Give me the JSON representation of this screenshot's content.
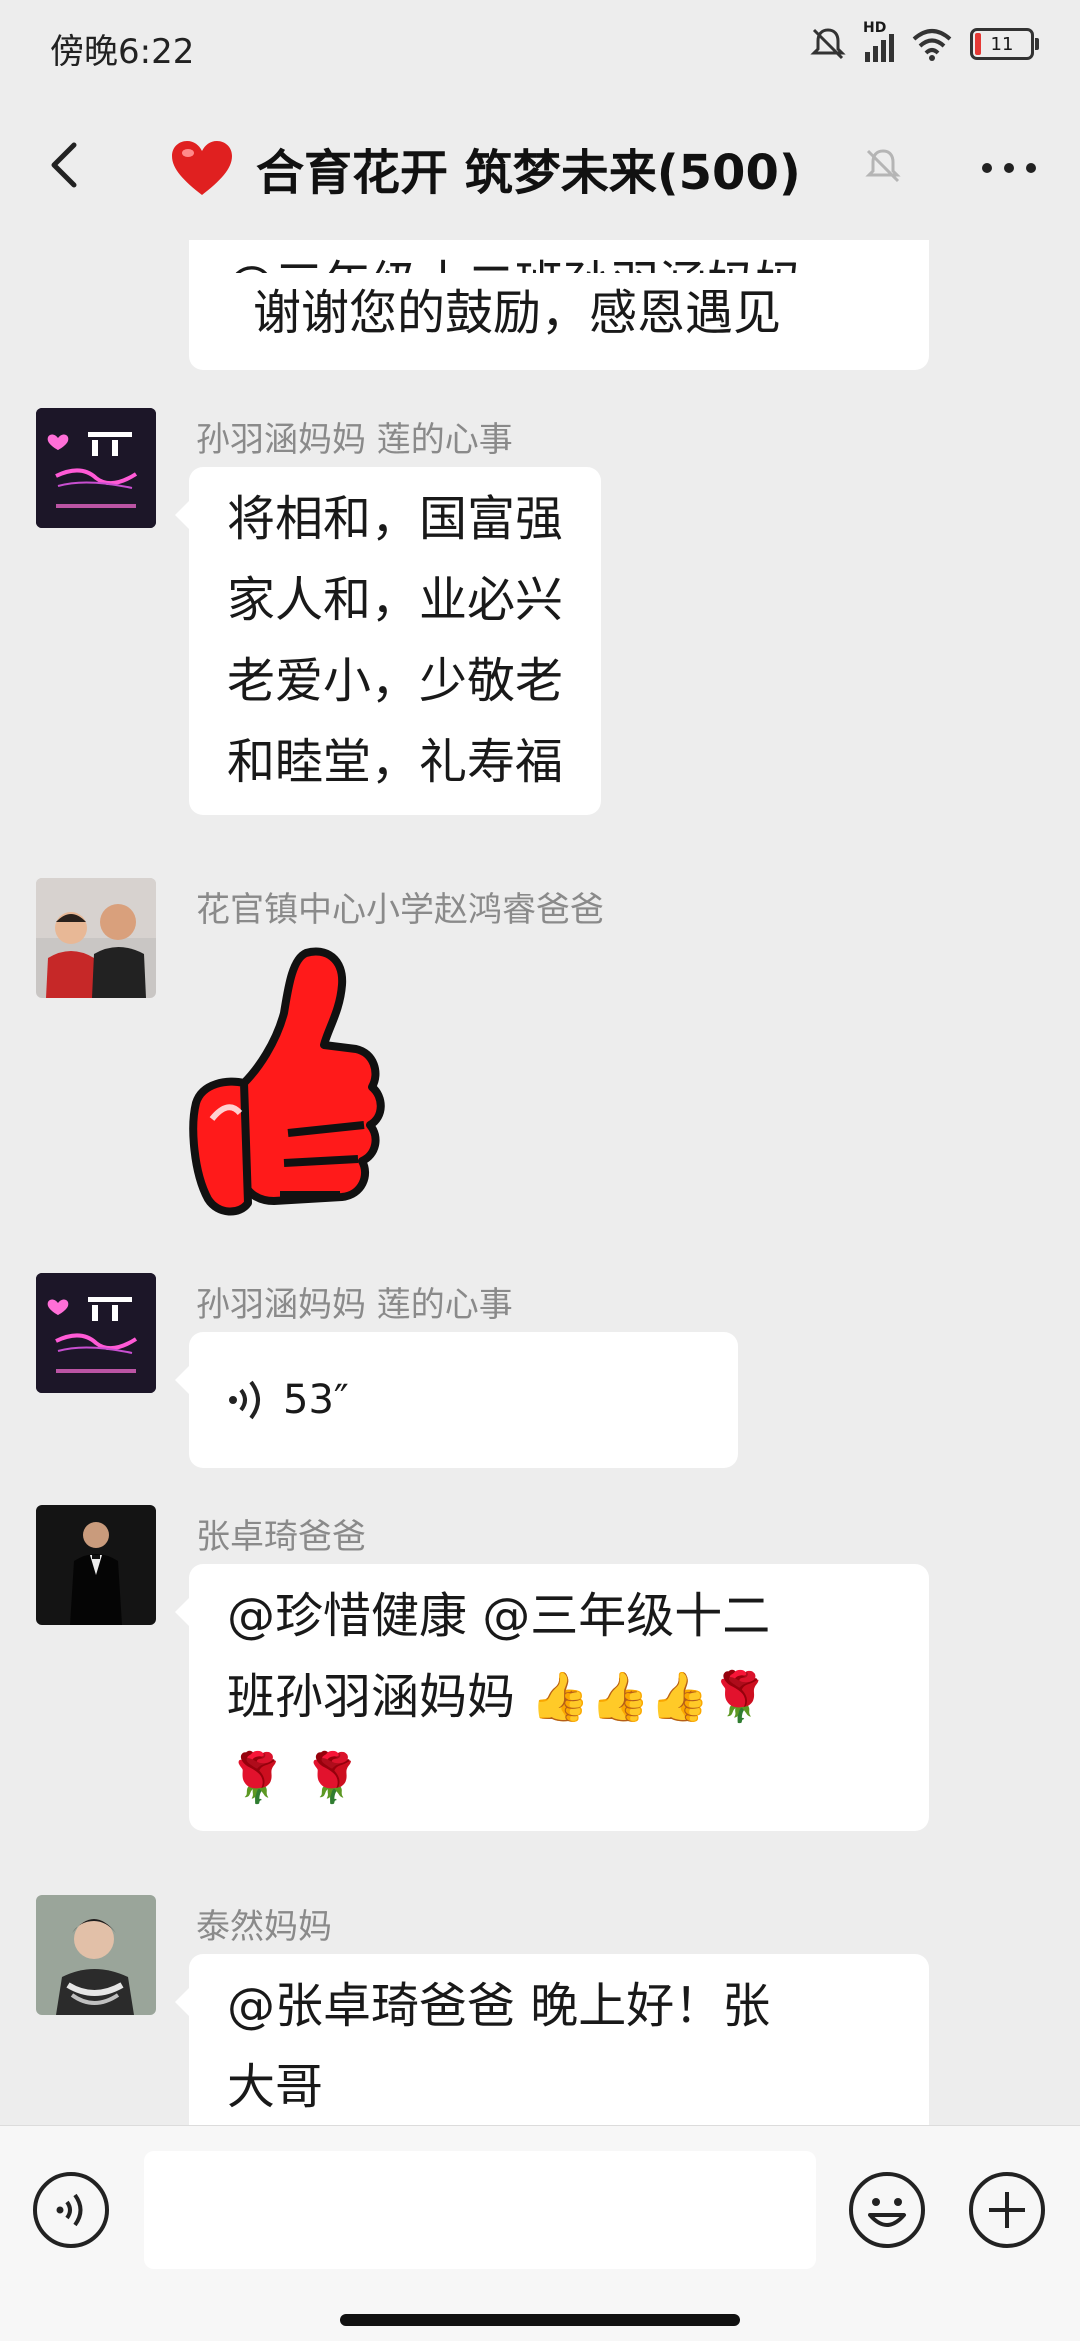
{
  "status_bar": {
    "time": "傍晚6:22",
    "battery_level": "11",
    "network": "HD"
  },
  "header": {
    "title": "合育花开 筑梦未来(500)"
  },
  "messages": [
    {
      "lines": [
        "谢谢您的鼓励，感恩遇见"
      ]
    },
    {
      "sender": "孙羽涵妈妈  莲的心事",
      "lines": [
        "将相和，国富强",
        "家人和，业必兴",
        "老爱小，少敬老",
        "和睦堂，礼寿福"
      ]
    },
    {
      "sender": "花官镇中心小学赵鸿睿爸爸",
      "sticker": "thumbs-up"
    },
    {
      "sender": "孙羽涵妈妈  莲的心事",
      "voice_duration": "53″"
    },
    {
      "sender": "张卓琦爸爸",
      "lines": [
        "@珍惜健康  @三年级十二",
        "班孙羽涵妈妈 👍👍👍🌹",
        "🌹 🌹"
      ]
    },
    {
      "sender": "泰然妈妈",
      "lines": [
        "@张卓琦爸爸  晚上好！张",
        "大哥"
      ]
    }
  ]
}
